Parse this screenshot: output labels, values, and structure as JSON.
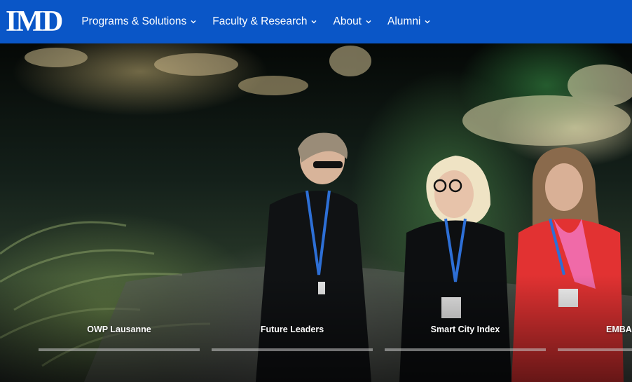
{
  "header": {
    "logo_text": "IMD",
    "nav": [
      {
        "label": "Programs & Solutions"
      },
      {
        "label": "Faculty & Research"
      },
      {
        "label": "About"
      },
      {
        "label": "Alumni"
      }
    ]
  },
  "carousel": {
    "tabs": [
      {
        "label": "OWP Lausanne",
        "progress": 0
      },
      {
        "label": "Future Leaders",
        "progress": 0
      },
      {
        "label": "Smart City Index",
        "progress": 0
      },
      {
        "label": "EMBA p",
        "progress": 0
      }
    ]
  },
  "colors": {
    "header_bg": "#0a56c7",
    "nav_text": "#ffffff",
    "tab_bar": "#c8c8c8"
  },
  "icons": {
    "nav_chevron": "chevron-down-icon"
  }
}
